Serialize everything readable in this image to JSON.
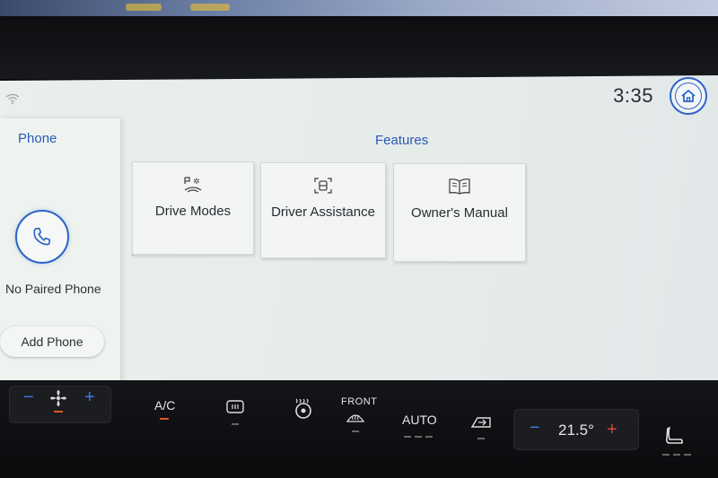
{
  "status": {
    "time": "3:35"
  },
  "phone_panel": {
    "title": "Phone",
    "status_text": "No Paired Phone",
    "add_button_label": "Add Phone"
  },
  "features": {
    "title": "Features",
    "tiles": [
      {
        "label": "Drive Modes",
        "icon": "drive-modes-icon"
      },
      {
        "label": "Driver Assistance",
        "icon": "driver-assistance-icon"
      },
      {
        "label": "Owner's Manual",
        "icon": "owners-manual-icon"
      }
    ]
  },
  "climate": {
    "fan_minus": "−",
    "fan_plus": "+",
    "ac_label": "A/C",
    "front_label": "FRONT",
    "auto_label": "AUTO",
    "temp_minus": "−",
    "temperature": "21.5°",
    "temp_plus": "+"
  },
  "colors": {
    "accent": "#2d63c8",
    "screen_bg": "#e9efec",
    "indicator": "#d9572b"
  }
}
